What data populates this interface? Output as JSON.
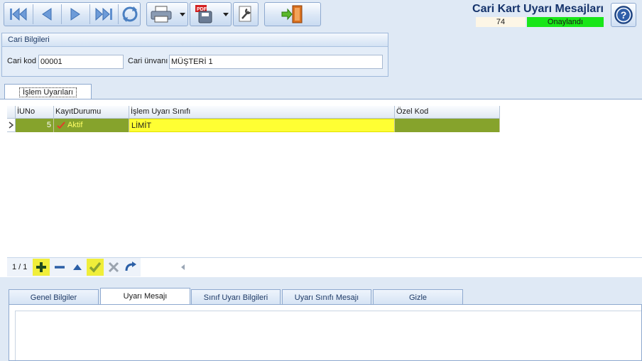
{
  "header": {
    "title": "Cari Kart Uyarı Mesajları",
    "record_number": "74",
    "status": "Onaylandı",
    "status_color": "#19e619"
  },
  "toolbar": {
    "icons": [
      "first-record-icon",
      "previous-record-icon",
      "next-record-icon",
      "last-record-icon",
      "refresh-icon",
      "print-icon",
      "export-pdf-icon",
      "tools-icon",
      "exit-door-icon",
      "help-icon"
    ]
  },
  "cari_bilgileri": {
    "title": "Cari Bilgileri",
    "kod_label": "Cari kod",
    "kod_value": "00001",
    "unvan_label": "Cari ünvanı",
    "unvan_value": "MÜŞTERİ 1"
  },
  "top_tab": {
    "label": "İşlem Uyarıları"
  },
  "grid": {
    "columns": [
      "İUNo",
      "KayıtDurumu",
      "İşlem Uyarı Sınıfı",
      "Özel Kod"
    ],
    "rows": [
      {
        "iuno": "5",
        "durum": "Aktif",
        "sinif": "LİMİT",
        "ozel_kod": ""
      }
    ],
    "highlight_color": "#ffff33",
    "row_color": "#86a32c"
  },
  "navigator": {
    "page_info": "1 / 1"
  },
  "lower_tabs": [
    {
      "label": "Genel Bilgiler"
    },
    {
      "label": "Uyarı Mesajı"
    },
    {
      "label": "Sınıf Uyarı Bilgileri"
    },
    {
      "label": "Uyarı Sınıfı Mesajı"
    },
    {
      "label": "Gizle"
    }
  ]
}
